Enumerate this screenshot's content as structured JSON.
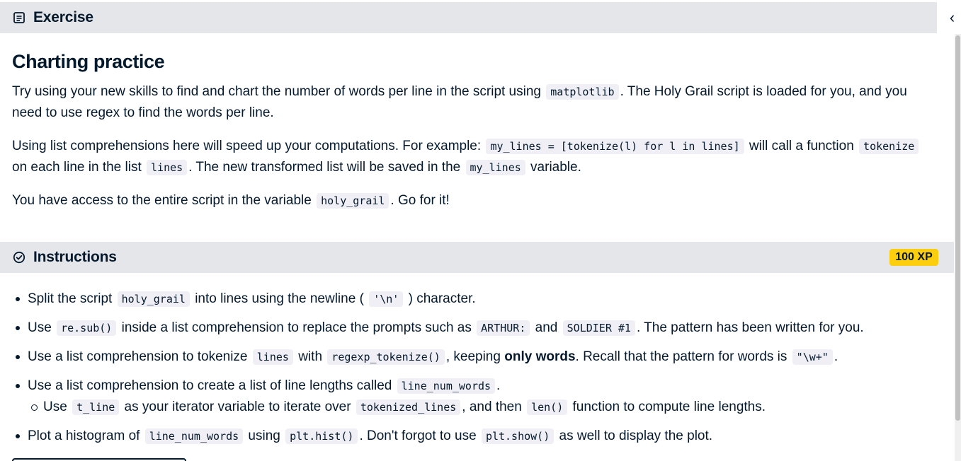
{
  "exercise_header": {
    "title": "Exercise",
    "collapse_glyph": "‹"
  },
  "page_title": "Charting practice",
  "p1": {
    "t1": "Try using your new skills to find and chart the number of words per line in the script using ",
    "c1": "matplotlib",
    "t2": ". The Holy Grail script is loaded for you, and you need to use regex to find the words per line."
  },
  "p2": {
    "t1": "Using list comprehensions here will speed up your computations. For example: ",
    "c1": "my_lines = [tokenize(l) for l in lines]",
    "t2": " will call a function ",
    "c2": "tokenize",
    "t3": " on each line in the list ",
    "c3": "lines",
    "t4": ". The new transformed list will be saved in the ",
    "c4": "my_lines",
    "t5": " variable."
  },
  "p3": {
    "t1": "You have access to the entire script in the variable ",
    "c1": "holy_grail",
    "t2": ". Go for it!"
  },
  "instructions_header": {
    "title": "Instructions",
    "xp": "100 XP"
  },
  "instructions": {
    "i1": {
      "t1": "Split the script ",
      "c1": "holy_grail",
      "t2": " into lines using the newline ( ",
      "c2": "'\\n'",
      "t3": " ) character."
    },
    "i2": {
      "t1": "Use ",
      "c1": "re.sub()",
      "t2": " inside a list comprehension to replace the prompts such as ",
      "c2": "ARTHUR:",
      "t3": " and ",
      "c3": "SOLDIER #1",
      "t4": ". The pattern has been written for you."
    },
    "i3": {
      "t1": "Use a list comprehension to tokenize ",
      "c1": "lines",
      "t2": " with ",
      "c2": "regexp_tokenize()",
      "t3": ", keeping ",
      "b1": "only words",
      "t4": ". Recall that the pattern for words is ",
      "c3": "\"\\w+\"",
      "t5": "."
    },
    "i4": {
      "t1": "Use a list comprehension to create a list of line lengths called ",
      "c1": "line_num_words",
      "t2": ".",
      "sub": {
        "t1": "Use ",
        "c1": "t_line",
        "t2": " as your iterator variable to iterate over ",
        "c2": "tokenized_lines",
        "t3": ", and then ",
        "c3": "len()",
        "t4": " function to compute line lengths."
      }
    },
    "i5": {
      "t1": "Plot a histogram of ",
      "c1": "line_num_words",
      "t2": " using ",
      "c2": "plt.hist()",
      "t3": ". Don't forgot to use ",
      "c3": "plt.show()",
      "t4": " as well to display the plot."
    }
  },
  "colors": {
    "header_bg": "#e5e6e9",
    "xp_badge": "#fcce0d",
    "text": "#05192d",
    "code_bg": "#efeff5"
  }
}
